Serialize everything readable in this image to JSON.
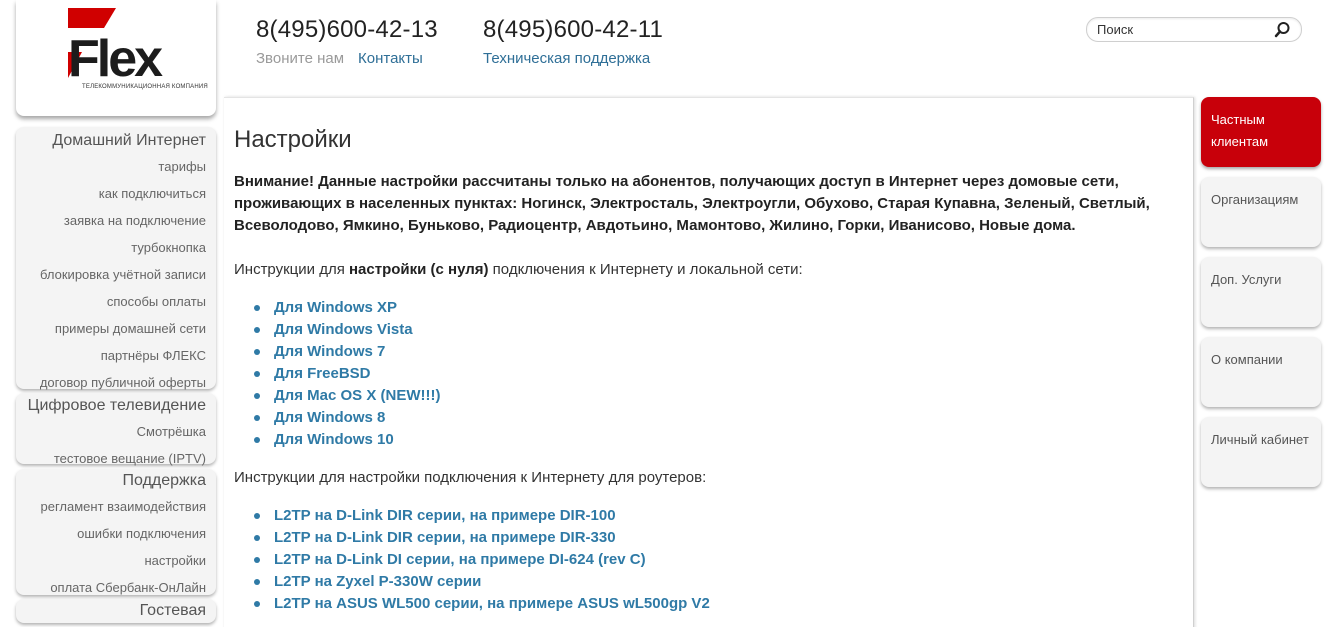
{
  "logo": {
    "text": "Flex",
    "tagline": "ТЕЛЕКОММУНИКАЦИОННАЯ КОМПАНИЯ",
    "accent": "#d00000"
  },
  "header": {
    "phone1": "8(495)600-42-13",
    "phone1_label": "Звоните нам",
    "phone1_link": "Контакты",
    "phone2": "8(495)600-42-11",
    "phone2_link": "Техническая поддержка"
  },
  "search": {
    "placeholder": "Поиск",
    "icon": "search-icon"
  },
  "sidebar": {
    "groups": [
      {
        "title": "Домашний Интернет",
        "items": [
          "тарифы",
          "как подключиться",
          "заявка на подключение",
          "турбокнопка",
          "блокировка учётной записи",
          "способы оплаты",
          "примеры домашней сети",
          "партнёры ФЛЕКС",
          "договор публичной оферты"
        ]
      },
      {
        "title": "Цифровое телевидение",
        "items": [
          "Смотрёшка",
          "тестовое вещание (IPTV)"
        ]
      },
      {
        "title": "Поддержка",
        "items": [
          "регламент взаимодействия",
          "ошибки подключения",
          "настройки",
          "оплата Сбербанк-ОнЛайн"
        ]
      },
      {
        "title": "Гостевая",
        "items": []
      }
    ]
  },
  "main": {
    "title": "Настройки",
    "warning": "Внимание! Данные настройки рассчитаны только на абонентов, получающих доступ в Интернет через домовые сети, проживающих в населенных пунктах: Ногинск, Электросталь, Электроугли, Обухово, Старая Купавна, Зеленый, Светлый, Всеволодово, Ямкино, Буньково, Радиоцентр, Авдотьино, Мамонтово, Жилино, Горки, Иванисово, Новые дома.",
    "intro1_pre": "Инструкции для ",
    "intro1_bold": "настройки (с нуля)",
    "intro1_post": " подключения к Интернету и локальной сети:",
    "os_links": [
      "Для Windows XP",
      "Для Windows Vista",
      "Для Windows 7",
      "Для FreeBSD",
      "Для Mac OS X (NEW!!!)",
      "Для Windows 8",
      "Для Windows 10"
    ],
    "intro2": "Инструкции для настройки подключения к Интернету для роутеров:",
    "router_links": [
      "L2TP на D-Link DIR серии, на примере DIR-100",
      "L2TP на D-Link DIR серии, на примере DIR-330",
      "L2TP на D-Link DI серии, на примере DI-624 (rev C)",
      "L2TP на Zyxel P-330W серии",
      "L2TP на ASUS WL500 серии, на примере ASUS wL500gp V2"
    ]
  },
  "right_nav": {
    "items": [
      "Частным клиентам",
      "Организациям",
      "Доп. Услуги",
      "О компании",
      "Личный кабинет"
    ],
    "active_index": 0
  }
}
